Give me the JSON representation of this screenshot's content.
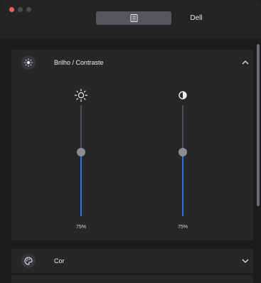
{
  "window": {
    "tabs": [
      {
        "icon": "document-list-icon",
        "active": true
      },
      {
        "label": "Dell",
        "active": false
      }
    ]
  },
  "sections": {
    "brightness": {
      "icon": "brightness-icon",
      "title": "Brilho / Contraste",
      "expanded": true,
      "sliders": [
        {
          "name": "brightness",
          "icon": "sun-icon",
          "value_label": "75%",
          "value": 0.75
        },
        {
          "name": "contrast",
          "icon": "contrast-icon",
          "value_label": "75%",
          "value": 0.75
        }
      ]
    },
    "color": {
      "icon": "palette-icon",
      "title": "Cor",
      "expanded": false
    }
  },
  "colors": {
    "accent": "#2d74e2",
    "close": "#ec5f57"
  }
}
